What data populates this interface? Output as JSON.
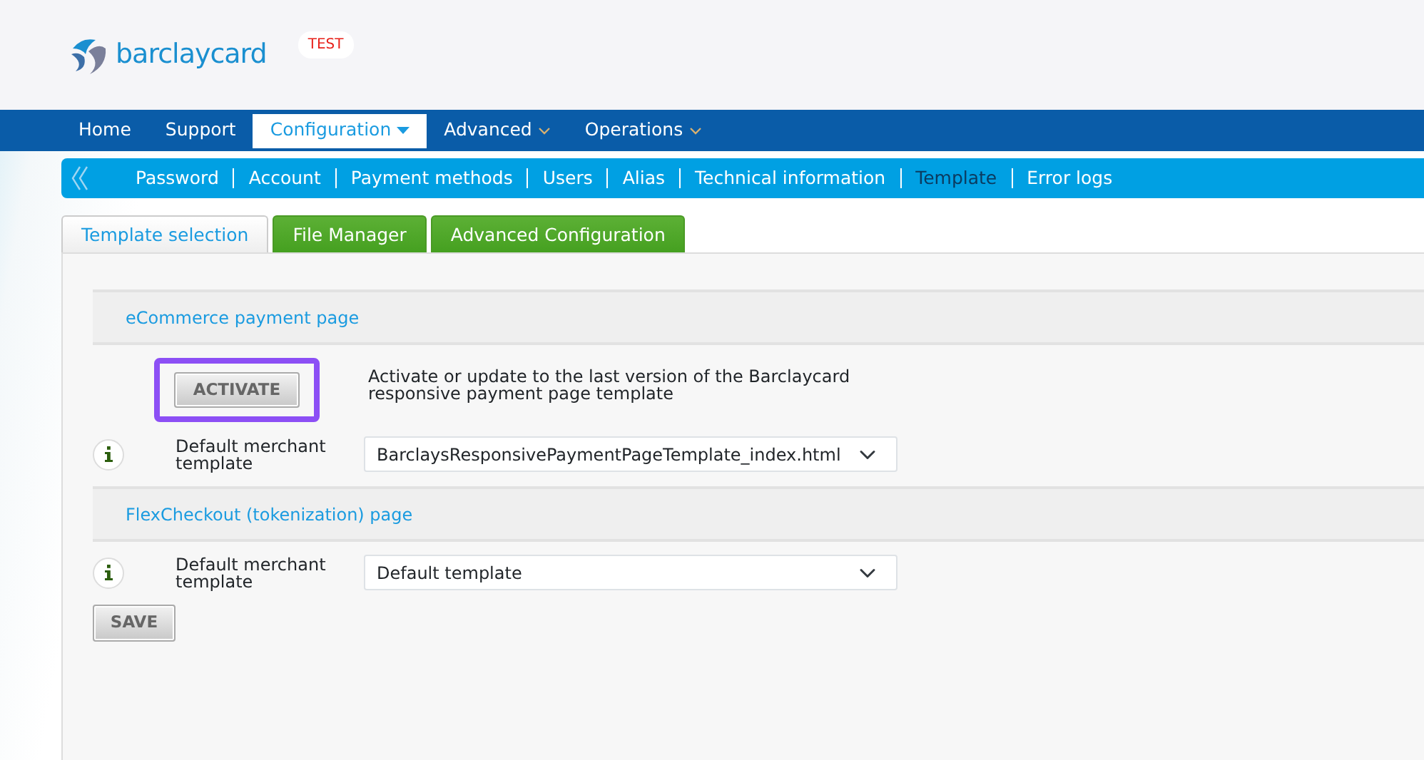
{
  "header": {
    "logo_text": "barclaycard",
    "env_badge": "TEST"
  },
  "main_nav": [
    {
      "label": "Home",
      "selected": false,
      "dropdown": false
    },
    {
      "label": "Support",
      "selected": false,
      "dropdown": false
    },
    {
      "label": "Configuration",
      "selected": true,
      "dropdown": true
    },
    {
      "label": "Advanced",
      "selected": false,
      "dropdown": true
    },
    {
      "label": "Operations",
      "selected": false,
      "dropdown": true
    }
  ],
  "sub_nav": [
    {
      "label": "Password",
      "selected": false
    },
    {
      "label": "Account",
      "selected": false
    },
    {
      "label": "Payment methods",
      "selected": false
    },
    {
      "label": "Users",
      "selected": false
    },
    {
      "label": "Alias",
      "selected": false
    },
    {
      "label": "Technical information",
      "selected": false
    },
    {
      "label": "Template",
      "selected": true
    },
    {
      "label": "Error logs",
      "selected": false
    }
  ],
  "tabs": [
    {
      "label": "Template selection",
      "selected": true
    },
    {
      "label": "File Manager",
      "selected": false
    },
    {
      "label": "Advanced Configuration",
      "selected": false
    }
  ],
  "sections": [
    {
      "title": "eCommerce payment page",
      "rows": [
        {
          "kind": "action",
          "button": "ACTIVATE",
          "highlighted": true,
          "description": "Activate or update to the last version of the Barclaycard responsive payment page template"
        },
        {
          "kind": "select",
          "label": "Default merchant template",
          "value": "BarclaysResponsivePaymentPageTemplate_index.html"
        }
      ]
    },
    {
      "title": "FlexCheckout (tokenization) page",
      "rows": [
        {
          "kind": "select",
          "label": "Default merchant template",
          "value": "Default template"
        }
      ]
    }
  ],
  "save_button": "SAVE"
}
